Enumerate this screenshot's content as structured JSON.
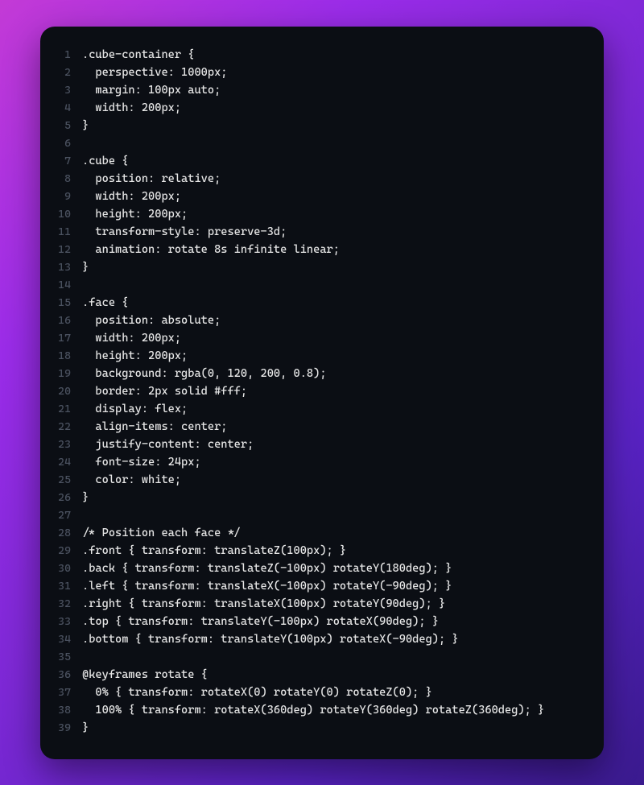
{
  "code": {
    "language": "css",
    "lines": [
      ".cube-container {",
      "  perspective: 1000px;",
      "  margin: 100px auto;",
      "  width: 200px;",
      "}",
      "",
      ".cube {",
      "  position: relative;",
      "  width: 200px;",
      "  height: 200px;",
      "  transform-style: preserve-3d;",
      "  animation: rotate 8s infinite linear;",
      "}",
      "",
      ".face {",
      "  position: absolute;",
      "  width: 200px;",
      "  height: 200px;",
      "  background: rgba(0, 120, 200, 0.8);",
      "  border: 2px solid #fff;",
      "  display: flex;",
      "  align-items: center;",
      "  justify-content: center;",
      "  font-size: 24px;",
      "  color: white;",
      "}",
      "",
      "/* Position each face */",
      ".front { transform: translateZ(100px); }",
      ".back { transform: translateZ(-100px) rotateY(180deg); }",
      ".left { transform: translateX(-100px) rotateY(-90deg); }",
      ".right { transform: translateX(100px) rotateY(90deg); }",
      ".top { transform: translateY(-100px) rotateX(90deg); }",
      ".bottom { transform: translateY(100px) rotateX(-90deg); }",
      "",
      "@keyframes rotate {",
      "  0% { transform: rotateX(0) rotateY(0) rotateZ(0); }",
      "  100% { transform: rotateX(360deg) rotateY(360deg) rotateZ(360deg); }",
      "}"
    ]
  }
}
